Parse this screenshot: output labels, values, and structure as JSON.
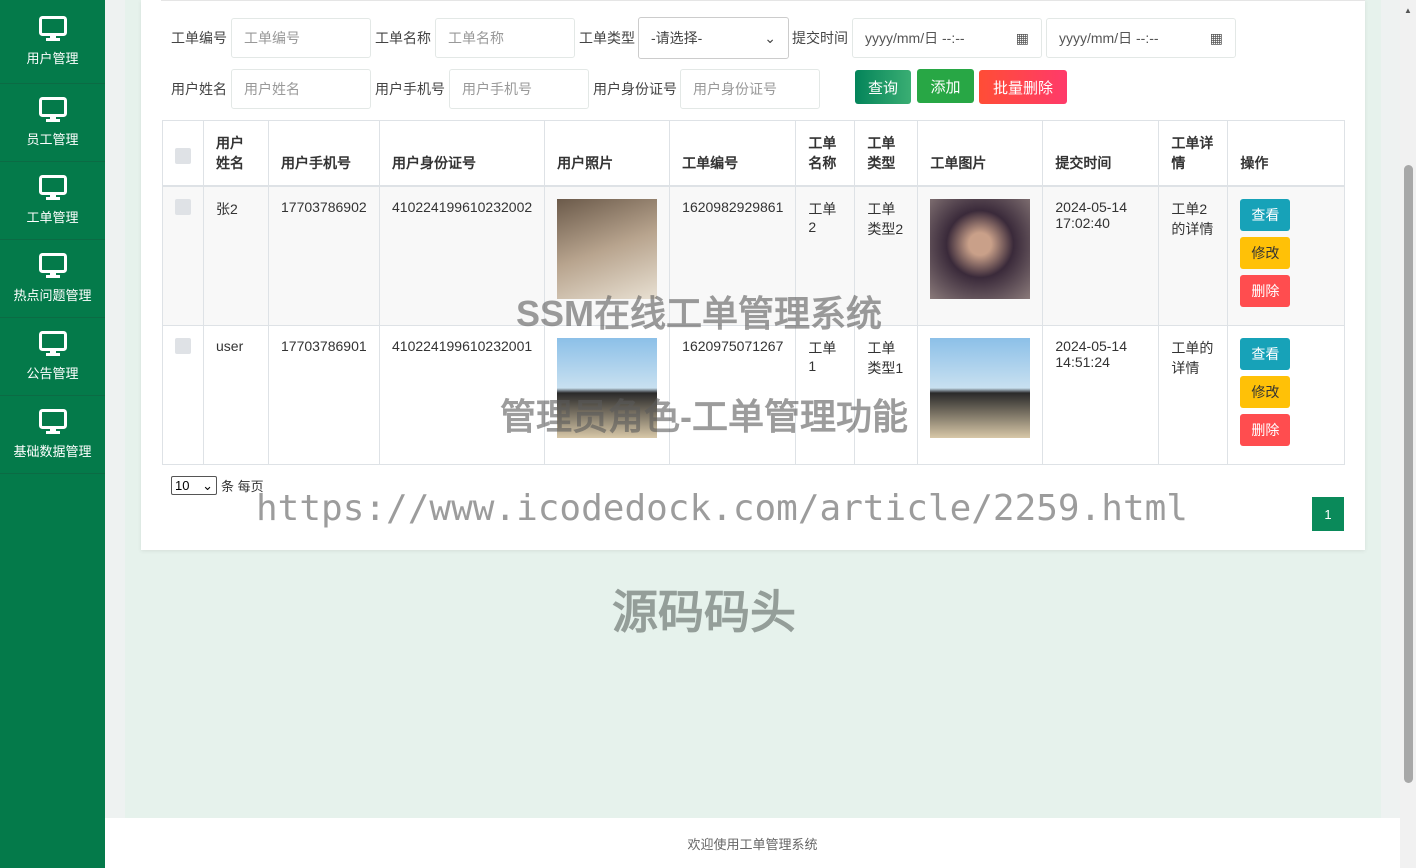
{
  "sidebar": {
    "items": [
      {
        "label": "用户管理"
      },
      {
        "label": "员工管理"
      },
      {
        "label": "工单管理"
      },
      {
        "label": "热点问题管理"
      },
      {
        "label": "公告管理"
      },
      {
        "label": "基础数据管理"
      }
    ]
  },
  "search": {
    "order_no_label": "工单编号",
    "order_no_placeholder": "工单编号",
    "order_name_label": "工单名称",
    "order_name_placeholder": "工单名称",
    "order_type_label": "工单类型",
    "order_type_value": "-请选择-",
    "submit_time_label": "提交时间",
    "date_placeholder": "yyyy/mm/日 --:--",
    "user_name_label": "用户姓名",
    "user_name_placeholder": "用户姓名",
    "user_phone_label": "用户手机号",
    "user_phone_placeholder": "用户手机号",
    "user_id_label": "用户身份证号",
    "user_id_placeholder": "用户身份证号",
    "query": "查询",
    "add": "添加",
    "batch_delete": "批量删除"
  },
  "table": {
    "headers": [
      "用户姓名",
      "用户手机号",
      "用户身份证号",
      "用户照片",
      "工单编号",
      "工单名称",
      "工单类型",
      "工单图片",
      "提交时间",
      "工单详情",
      "操作"
    ],
    "rows": [
      {
        "name": "张2",
        "phone": "17703786902",
        "idno": "410224199610232002",
        "order_no": "1620982929861",
        "order_name": "工单2",
        "order_type": "工单类型2",
        "time": "2024-05-14 17:02:40",
        "detail": "工单2的详情"
      },
      {
        "name": "user",
        "phone": "17703786901",
        "idno": "410224199610232001",
        "order_no": "1620975071267",
        "order_name": "工单1",
        "order_type": "工单类型1",
        "time": "2024-05-14 14:51:24",
        "detail": "工单的详情"
      }
    ],
    "actions": {
      "view": "查看",
      "edit": "修改",
      "delete": "删除"
    }
  },
  "pagination": {
    "page_size": "10",
    "per_page_label": "条 每页",
    "current_page": "1"
  },
  "watermarks": [
    "SSM在线工单管理系统",
    "管理员角色-工单管理功能",
    "https://www.icodedock.com/article/2259.html",
    "源码码头"
  ],
  "footer": "欢迎使用工单管理系统",
  "colors": {
    "sidebar": "#047a4a",
    "query": "#0a8a5a",
    "add": "#28a745",
    "delete": "#ff4d4f",
    "view": "#17a2b8",
    "edit": "#ffc107"
  }
}
